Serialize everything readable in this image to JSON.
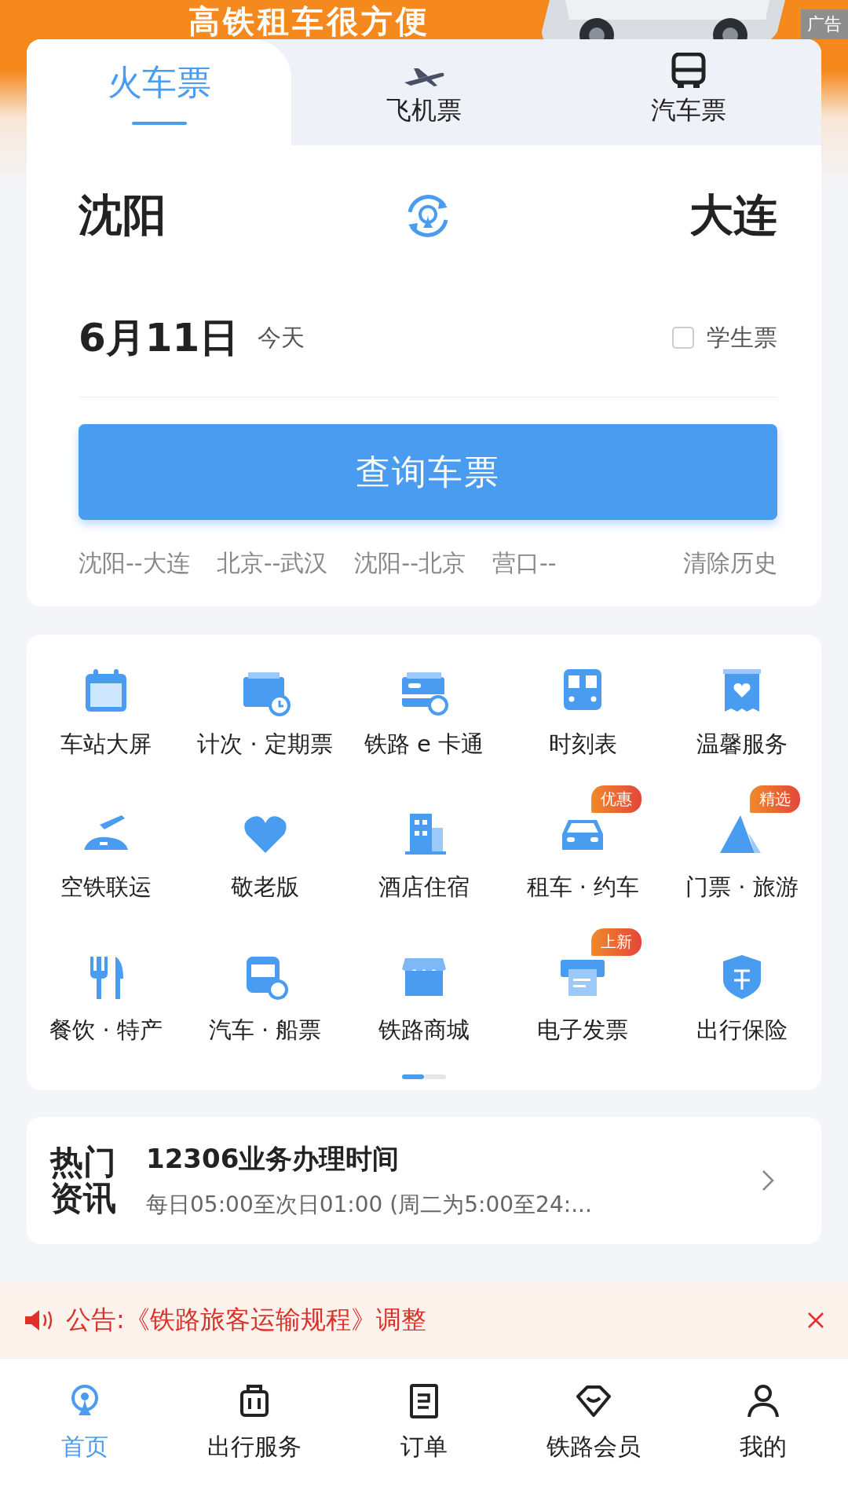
{
  "banner": {
    "headline": "高铁租车很方便",
    "ad_tag": "广告"
  },
  "tabs": [
    {
      "label": "火车票",
      "selected": true
    },
    {
      "label": "飞机票",
      "selected": false
    },
    {
      "label": "汽车票",
      "selected": false
    }
  ],
  "route": {
    "from": "沈阳",
    "to": "大连"
  },
  "date": {
    "value": "6月11日",
    "day": "今天"
  },
  "student_ticket": {
    "label": "学生票",
    "checked": false
  },
  "search_button": "查询车票",
  "history": [
    "沈阳--大连",
    "北京--武汉",
    "沈阳--北京",
    "营口--"
  ],
  "clear_history": "清除历史",
  "services": [
    {
      "label": "车站大屏"
    },
    {
      "label": "计次 · 定期票"
    },
    {
      "label": "铁路 e 卡通"
    },
    {
      "label": "时刻表"
    },
    {
      "label": "温馨服务"
    },
    {
      "label": "空铁联运"
    },
    {
      "label": "敬老版"
    },
    {
      "label": "酒店住宿"
    },
    {
      "label": "租车 · 约车",
      "badge": "优惠"
    },
    {
      "label": "门票 · 旅游",
      "badge": "精选"
    },
    {
      "label": "餐饮 · 特产"
    },
    {
      "label": "汽车 · 船票"
    },
    {
      "label": "铁路商城"
    },
    {
      "label": "电子发票",
      "badge": "上新"
    },
    {
      "label": "出行保险"
    }
  ],
  "pages": [
    {
      "selected": true
    },
    {
      "selected": false
    }
  ],
  "news": {
    "logo": "热门资讯",
    "title": "12306业务办理时间",
    "summary": "每日05:00至次日01:00 (周二为5:00至24:..."
  },
  "notice": {
    "text": "公告:《铁路旅客运输规程》调整"
  },
  "nav": [
    {
      "label": "首页",
      "selected": true
    },
    {
      "label": "出行服务",
      "selected": false
    },
    {
      "label": "订单",
      "selected": false
    },
    {
      "label": "铁路会员",
      "selected": false
    },
    {
      "label": "我的",
      "selected": false
    }
  ]
}
